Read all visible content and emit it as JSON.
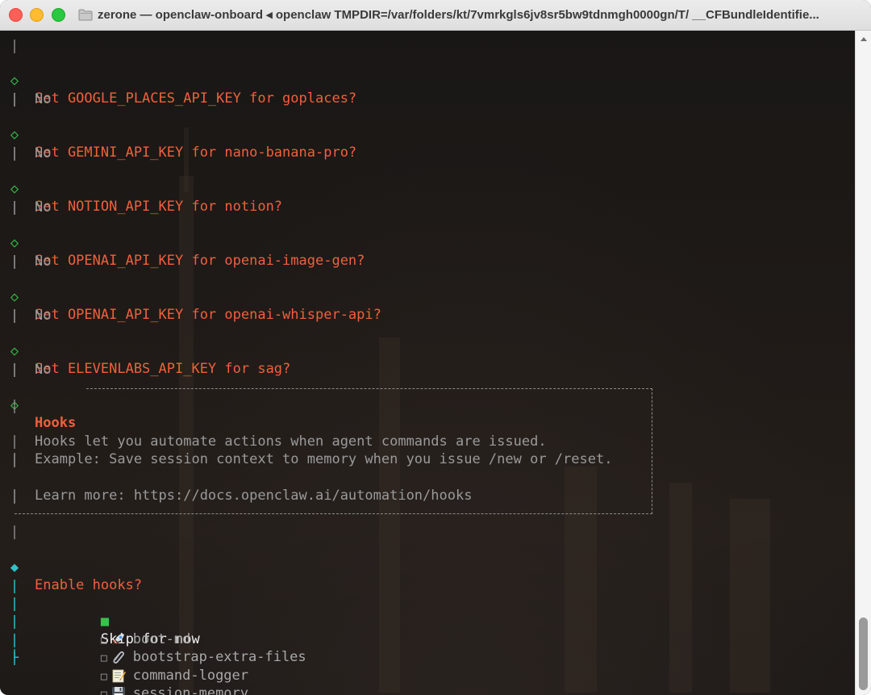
{
  "window": {
    "title": "zerone — openclaw-onboard ◂ openclaw TMPDIR=/var/folders/kt/7vmrkgls6jv8sr5bw9tdnmgh0000gn/T/ __CFBundleIdentifie..."
  },
  "prompts": [
    {
      "question": "Set GOOGLE_PLACES_API_KEY for goplaces?",
      "answer": "No"
    },
    {
      "question": "Set GEMINI_API_KEY for nano-banana-pro?",
      "answer": "No"
    },
    {
      "question": "Set NOTION_API_KEY for notion?",
      "answer": "No"
    },
    {
      "question": "Set OPENAI_API_KEY for openai-image-gen?",
      "answer": "No"
    },
    {
      "question": "Set OPENAI_API_KEY for openai-whisper-api?",
      "answer": "No"
    },
    {
      "question": "Set ELEVENLABS_API_KEY for sag?",
      "answer": "No"
    }
  ],
  "hooks_box": {
    "title": "Hooks",
    "line1": "Hooks let you automate actions when agent commands are issued.",
    "line2": "Example: Save session context to memory when you issue /new or /reset.",
    "learn_more": "Learn more: https://docs.openclaw.ai/automation/hooks"
  },
  "enable_hooks": {
    "question": "Enable hooks?",
    "options": [
      {
        "label": "Skip for now",
        "selected": true,
        "icon": ""
      },
      {
        "label": "boot-md",
        "selected": false,
        "icon": "rocket-icon"
      },
      {
        "label": "bootstrap-extra-files",
        "selected": false,
        "icon": "paperclip-icon"
      },
      {
        "label": "command-logger",
        "selected": false,
        "icon": "memo-icon"
      },
      {
        "label": "session-memory",
        "selected": false,
        "icon": "floppy-disk-icon"
      }
    ]
  },
  "colors": {
    "question": "#f0603c",
    "answer": "#9a9a9a",
    "done_marker": "#37b84a",
    "active_marker": "#2ec1c7"
  }
}
